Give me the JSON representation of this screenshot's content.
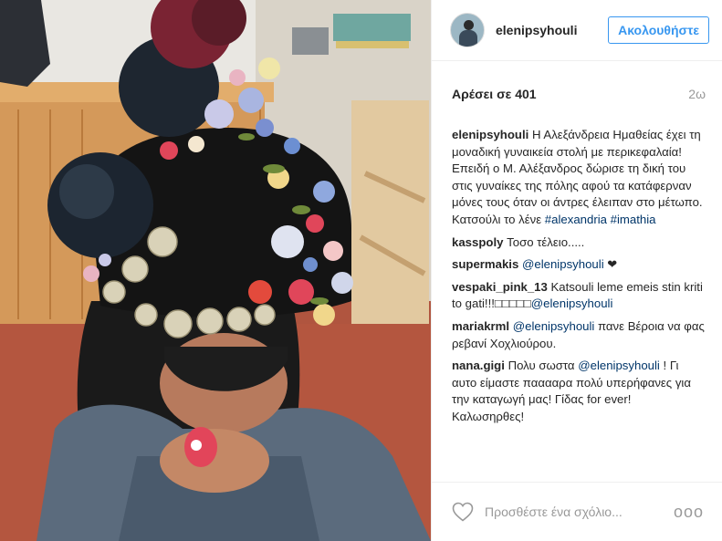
{
  "header": {
    "username": "elenipsyhouli",
    "follow_label": "Ακολουθήστε"
  },
  "likes": {
    "label": "Αρέσει σε 401",
    "time": "2ω"
  },
  "caption": {
    "user": "elenipsyhouli",
    "text": "Η Αλεξάνδρεια Ημαθείας έχει τη μοναδική γυναικεία στολή με περικεφαλαία!Επειδή ο Μ. Αλέξανδρος δώρισε τη δική του στις γυναίκες της πόλης αφού τα κατάφερναν μόνες τους όταν οι άντρες έλειπαν στο μέτωπο. Κατσούλι το λένε ",
    "tag1": "#alexandria",
    "tag2": "#imathia"
  },
  "comments": [
    {
      "user": "kasspoly",
      "text": "Τοσο τέλειο....."
    },
    {
      "user": "supermakis",
      "mention": "@elenipsyhouli",
      "text": " ❤"
    },
    {
      "user": "vespaki_pink_13",
      "text": "Katsouli leme emeis stin kriti to gati!!!□□□□□",
      "mention": "@elenipsyhouli"
    },
    {
      "user": "mariakrml",
      "mention": "@elenipsyhouli",
      "text": " πανε Βέροια να φας ρεβανί Χοχλιούρου."
    },
    {
      "user": "nana.gigi",
      "text": "Πολυ σωστα ",
      "mention": "@elenipsyhouli",
      "text2": " ! Γι αυτο είμαστε πααααρα πολύ υπερήφανες για την καταγωγή μας! Γίδας for ever! Καλωσηρθες!"
    }
  ],
  "footer": {
    "placeholder": "Προσθέστε ένα σχόλιο...",
    "more": "ooo"
  },
  "colors": {
    "accent": "#3897f0",
    "link": "#003569",
    "muted": "#999999"
  },
  "icons": {
    "like": "heart-icon",
    "more": "more-options-icon"
  }
}
